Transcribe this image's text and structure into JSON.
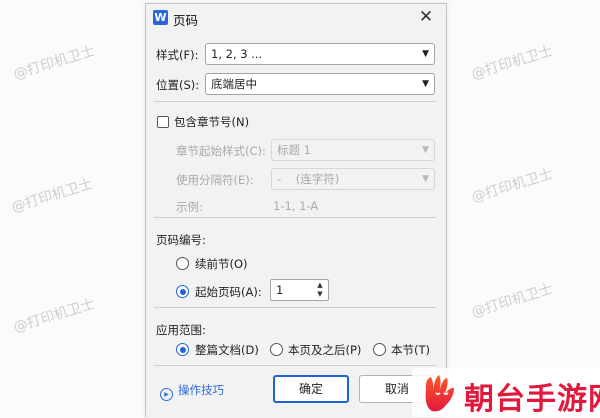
{
  "watermark_text": "@打印机卫士",
  "dialog": {
    "title": "页码",
    "app_icon_letter": "W",
    "close_glyph": "✕"
  },
  "style_field": {
    "label": "样式(F):",
    "value": "1, 2, 3 ..."
  },
  "position_field": {
    "label": "位置(S):",
    "value": "底端居中"
  },
  "include_chapter": {
    "label": "包含章节号(N)",
    "checked": false
  },
  "chapter_start_style": {
    "label": "章节起始样式(C):",
    "value": "标题 1"
  },
  "separator": {
    "label": "使用分隔符(E):",
    "value": "-    (连字符)"
  },
  "example": {
    "label": "示例:",
    "value": "1-1, 1-A"
  },
  "numbering": {
    "heading": "页码编号:",
    "continue_label": "续前节(O)",
    "start_at_label": "起始页码(A):",
    "start_at_value": "1",
    "selected": "start_at"
  },
  "apply_to": {
    "heading": "应用范围:",
    "options": [
      "整篇文档(D)",
      "本页及之后(P)",
      "本节(T)"
    ],
    "selected": "整篇文档(D)"
  },
  "buttons": {
    "tips": "操作技巧",
    "ok": "确定",
    "cancel": "取消"
  },
  "brand": {
    "name": "朝台手游网"
  },
  "colors": {
    "accent": "#1f63d6",
    "brand_red": "#e0193d",
    "icon_blue": "#2b66d9"
  }
}
